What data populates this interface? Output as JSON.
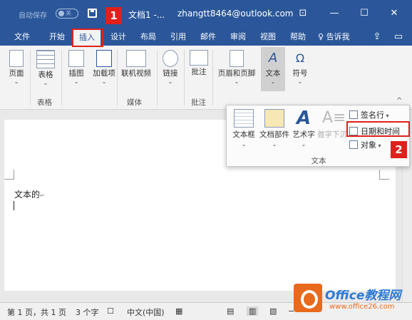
{
  "titlebar": {
    "autosave_label": "自动保存",
    "autosave_state": "关",
    "doc_name": "文档1 -...",
    "user_email": "zhangtt8464@outlook.com",
    "icons": [
      "save-icon",
      "ribbon-display-icon",
      "minimize-icon",
      "maximize-icon",
      "close-icon"
    ]
  },
  "ribbon_tabs": [
    "文件",
    "开始",
    "插入",
    "设计",
    "布局",
    "引用",
    "邮件",
    "审阅",
    "视图",
    "帮助"
  ],
  "active_tab": "插入",
  "tell_me": "告诉我",
  "ribbon": {
    "pages": {
      "label": "页面"
    },
    "table": {
      "label": "表格",
      "group": "表格"
    },
    "illustrations": {
      "label": "插图"
    },
    "addins": {
      "label": "加载项"
    },
    "online_video": {
      "label": "联机视频",
      "group": "媒体"
    },
    "link": {
      "label": "链接"
    },
    "comment": {
      "label": "批注",
      "group": "批注"
    },
    "header_footer": {
      "label": "页眉和页脚"
    },
    "text": {
      "label": "文本"
    },
    "symbol": {
      "label": "符号"
    }
  },
  "text_popup": {
    "textbox": "文本框",
    "quick_parts": "文档部件",
    "wordart": "艺术字",
    "dropcap": "首字下沉",
    "signature_line": "签名行",
    "date_time": "日期和时间",
    "object": "对象",
    "group_title": "文本"
  },
  "document": {
    "text": "文本的"
  },
  "annotations": {
    "step1": "1",
    "step2": "2"
  },
  "status": {
    "page": "第 1 页，共 1 页",
    "words": "3 个字",
    "language": "中文(中国)"
  },
  "watermark": {
    "line1": "Office教程网",
    "line2": "www.office26.com"
  },
  "colors": {
    "accent": "#2b579a",
    "highlight": "#e0201b",
    "watermark_orange": "#e86a1c"
  }
}
